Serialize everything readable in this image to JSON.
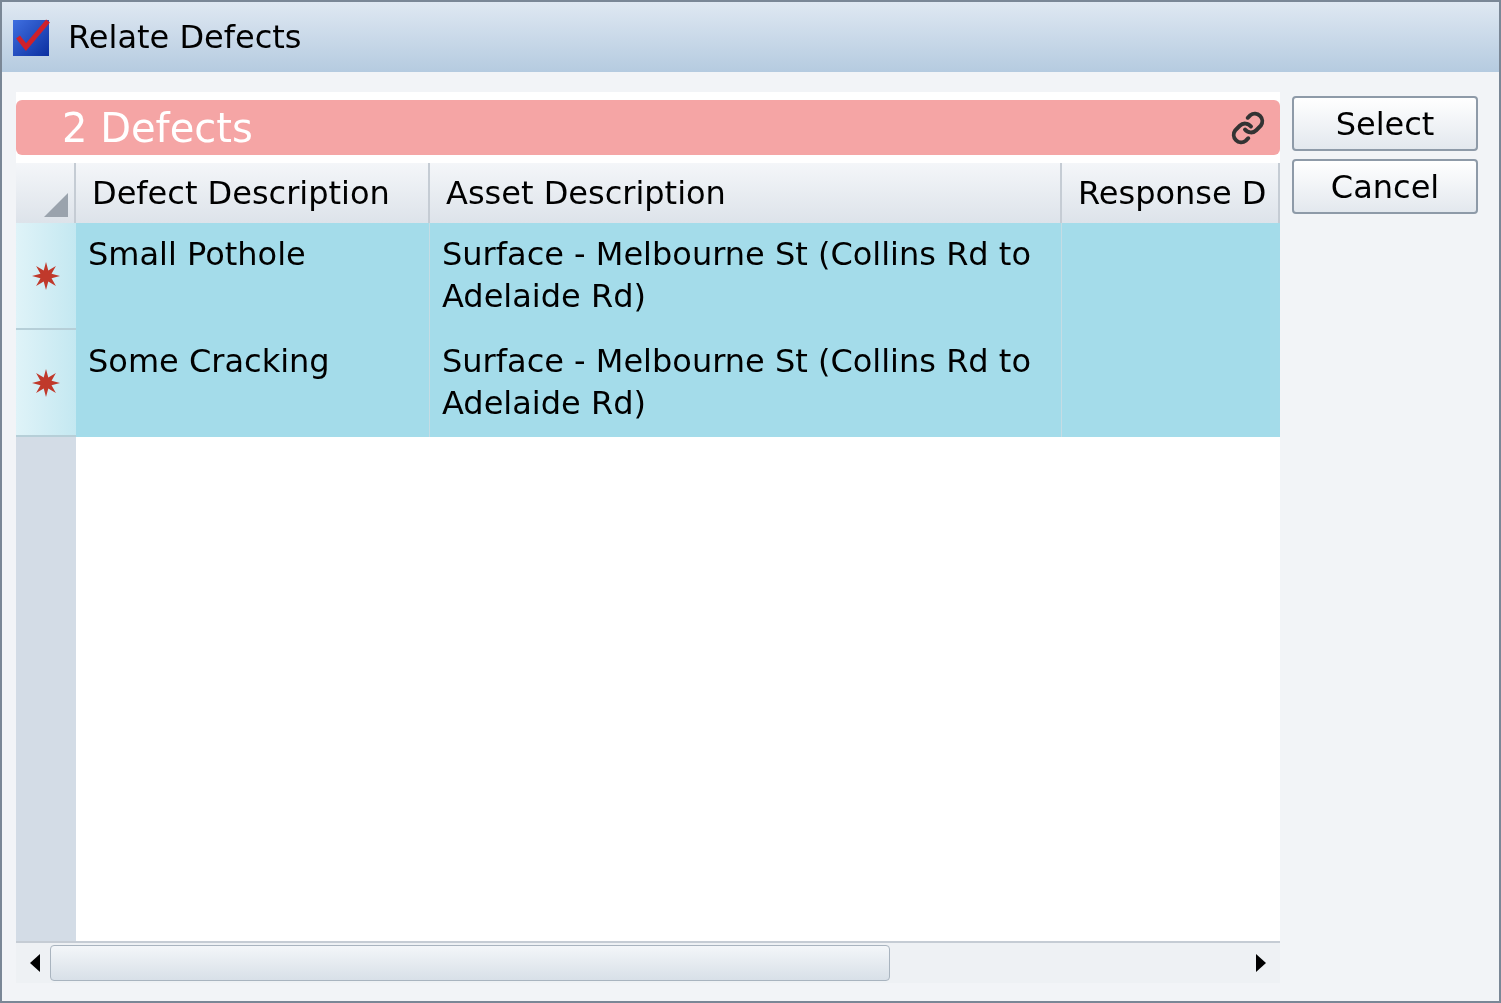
{
  "window": {
    "title": "Relate Defects"
  },
  "grid": {
    "banner": "2 Defects",
    "columns": [
      "Defect Description",
      "Asset Description",
      "Response D"
    ],
    "rows": [
      {
        "defect": "Small Pothole",
        "asset": "Surface - Melbourne St (Collins Rd to Adelaide Rd)",
        "selected": true
      },
      {
        "defect": "Some Cracking",
        "asset": "Surface - Melbourne St (Collins Rd to Adelaide Rd)",
        "selected": true
      }
    ]
  },
  "buttons": [
    "Select",
    "Cancel"
  ]
}
